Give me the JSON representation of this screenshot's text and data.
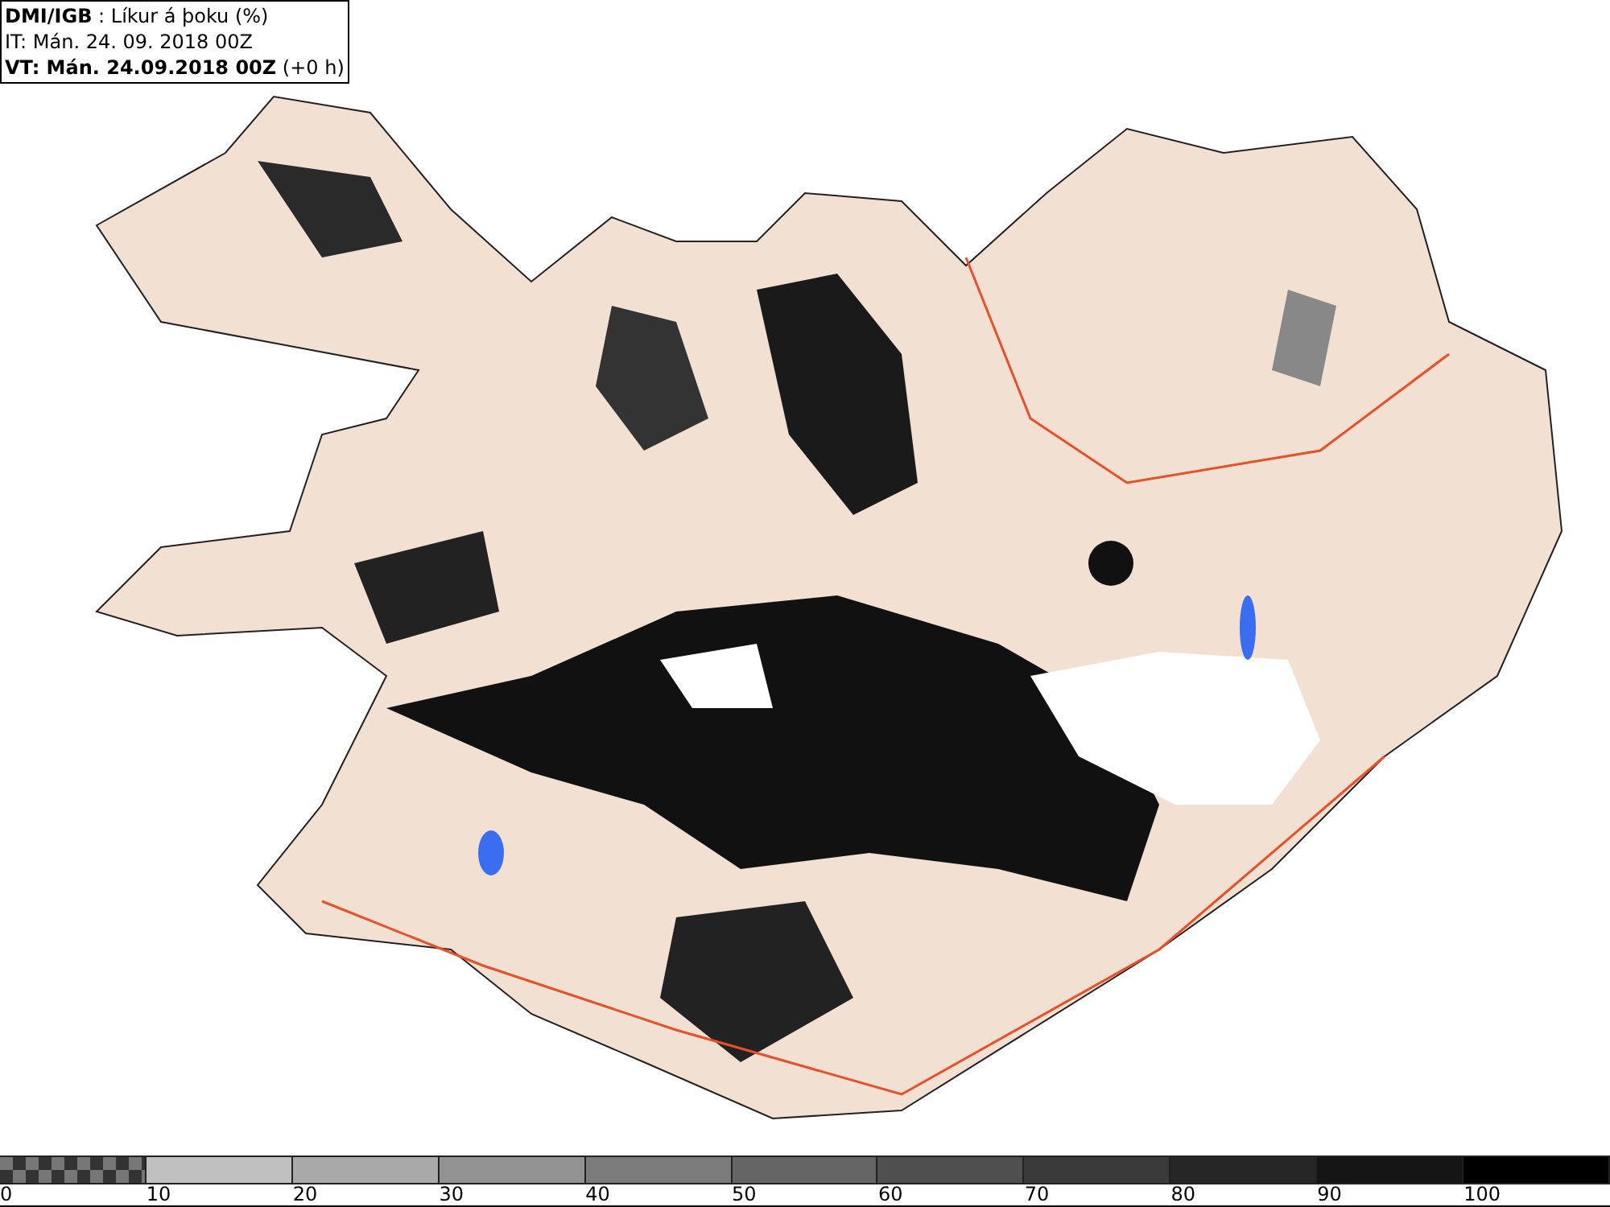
{
  "info_box": {
    "lines": [
      "**DMI/IGB** : Líkur á þoku (%)",
      "IT: Mán. 24. 09. 2018 00Z",
      "**VT: Mán. 24.09.2018 00Z** (+0 h)"
    ]
  },
  "legend": [
    {
      "label": "0",
      "kind": "checker"
    },
    {
      "label": "10",
      "kind": "solid",
      "color": "#c0c0c0"
    },
    {
      "label": "20",
      "kind": "solid",
      "color": "#a9a9a9"
    },
    {
      "label": "30",
      "kind": "solid",
      "color": "#939393"
    },
    {
      "label": "40",
      "kind": "solid",
      "color": "#7b7b7b"
    },
    {
      "label": "50",
      "kind": "solid",
      "color": "#656565"
    },
    {
      "label": "60",
      "kind": "solid",
      "color": "#4f4f4f"
    },
    {
      "label": "70",
      "kind": "solid",
      "color": "#3a3a3a"
    },
    {
      "label": "80",
      "kind": "solid",
      "color": "#262626"
    },
    {
      "label": "90",
      "kind": "solid",
      "color": "#141414"
    },
    {
      "label": "100",
      "kind": "solid",
      "color": "#000000"
    }
  ]
}
